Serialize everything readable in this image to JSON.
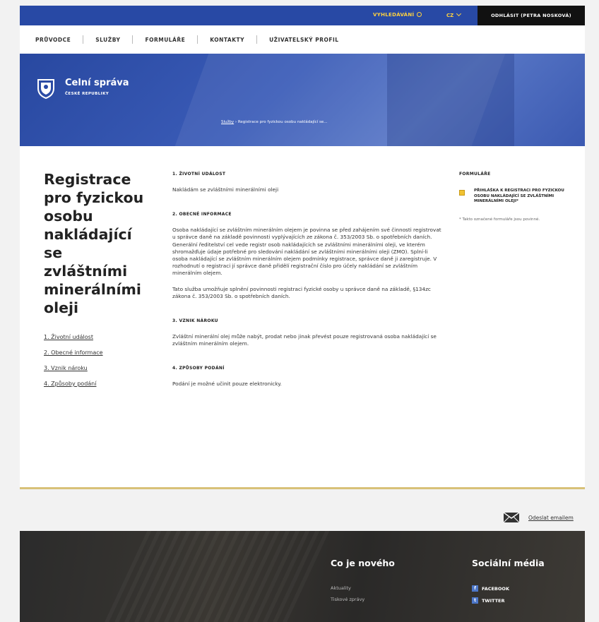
{
  "topbar": {
    "search_label": "VYHLEDÁVÁNÍ",
    "language": "CZ",
    "logout_label": "ODHLÁSIT (PETRA NOSKOVÁ)"
  },
  "nav": {
    "items": [
      "PRŮVODCE",
      "SLUŽBY",
      "FORMULÁŘE",
      "KONTAKTY",
      "UŽIVATELSKÝ PROFIL"
    ]
  },
  "hero": {
    "brand_title": "Celní správa",
    "brand_subtitle": "ČESKÉ REPUBLIKY",
    "breadcrumb_link": "Služby",
    "breadcrumb_separator": "›",
    "breadcrumb_current": "Registrace pro fyzickou osobu nakládající se..."
  },
  "content": {
    "title": "Registrace pro fyzickou osobu nakládající se zvláštními minerálními oleji",
    "toc": [
      "1. Životní událost",
      "2. Obecné informace",
      "3. Vznik nároku",
      "4. Způsoby podání"
    ],
    "sections": [
      {
        "heading": "1. ŽIVOTNÍ UDÁLOST",
        "paragraphs": [
          "Nakládám se zvláštními minerálními oleji"
        ]
      },
      {
        "heading": "2. OBECNÉ INFORMACE",
        "paragraphs": [
          "Osoba nakládající se zvláštním minerálním olejem je povinna se před zahájením své činnosti registrovat u správce daně na základě povinnosti vyplývajících ze zákona č. 353/2003 Sb. o spotřebních daních. Generální ředitelství cel vede registr osob nakládajících se zvláštními minerálními oleji, ve kterém shromažďuje údaje potřebné pro sledování nakládání se zvláštními minerálními oleji (ZMO). Splní-li osoba nakládající se zvláštním minerálním olejem podmínky registrace, správce daně ji zaregistruje. V rozhodnutí o registraci jí správce daně přidělí registrační číslo pro účely nakládání se zvláštním minerálním olejem.",
          "Tato služba umožňuje splnění povinnosti registraci fyzické osoby u správce daně na základě, §134zc zákona č. 353/2003 Sb. o spotřebních daních."
        ]
      },
      {
        "heading": "3. VZNIK NÁROKU",
        "paragraphs": [
          "Zvláštní minerální olej může nabýt, prodat nebo jinak převést pouze registrovaná osoba nakládající se zvláštním minerálním olejem."
        ]
      },
      {
        "heading": "4. ZPŮSOBY PODÁNÍ",
        "paragraphs": [
          "Podání je možné učinit pouze elektronicky."
        ]
      }
    ]
  },
  "aside": {
    "heading": "FORMULÁŘE",
    "form_link": "PŘIHLÁŠKA K REGISTRACI PRO FYZICKOU OSOBU NAKLÁDAJÍCÍ SE ZVLÁŠTNÍMI MINERÁLNÍMI OLEJI*",
    "note": "* Takto označené formuláře jsou povinné."
  },
  "email_label": "Odeslat emailem",
  "footer": {
    "news_heading": "Co je nového",
    "news_links": [
      "Aktuality",
      "Tiskové zprávy"
    ],
    "social_heading": "Sociální média",
    "social_links": [
      "FACEBOOK",
      "TWITTER"
    ]
  },
  "colors": {
    "brand_blue": "#2849a5",
    "accent_yellow": "#ffd23f",
    "card_border_gold": "#d8c178"
  }
}
